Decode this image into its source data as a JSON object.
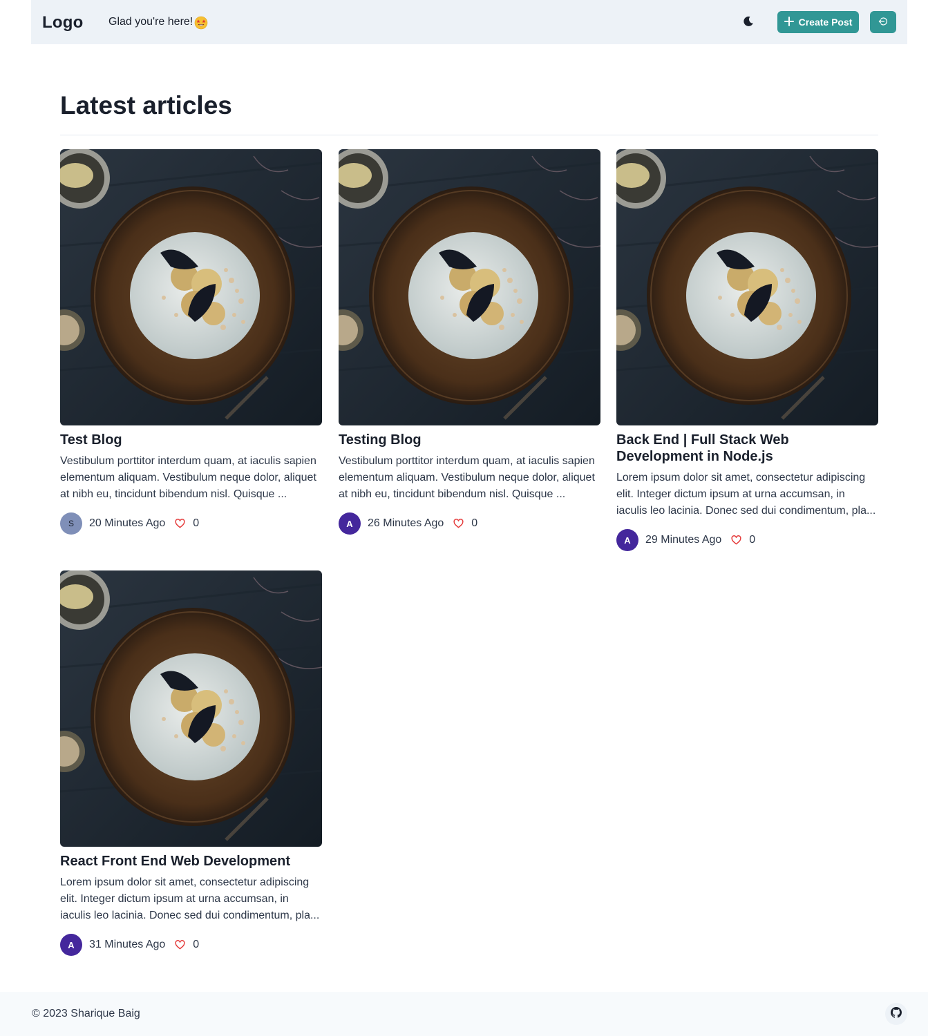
{
  "header": {
    "logo": "Logo",
    "greeting": "Glad you're here!",
    "create_label": "Create Post",
    "accent": "#319795"
  },
  "main": {
    "title": "Latest articles",
    "articles": [
      {
        "title": "Test Blog",
        "description": "Vestibulum porttitor interdum quam, at iaculis sapien elementum aliquam. Vestibulum neque dolor, aliquet at nibh eu, tincidunt bibendum nisl. Quisque ...",
        "avatar_initial": "S",
        "avatar_color": "#7f8fb8",
        "time": "20 Minutes Ago",
        "likes": "0"
      },
      {
        "title": "Testing Blog",
        "description": "Vestibulum porttitor interdum quam, at iaculis sapien elementum aliquam. Vestibulum neque dolor, aliquet at nibh eu, tincidunt bibendum nisl. Quisque ...",
        "avatar_initial": "A",
        "avatar_color": "#44279c",
        "time": "26 Minutes Ago",
        "likes": "0"
      },
      {
        "title": "Back End | Full Stack Web Development in Node.js",
        "description": "Lorem ipsum dolor sit amet, consectetur adipiscing elit. Integer dictum ipsum at urna accumsan, in iaculis leo lacinia. Donec sed dui condimentum, pla...",
        "avatar_initial": "A",
        "avatar_color": "#44279c",
        "time": "29 Minutes Ago",
        "likes": "0"
      },
      {
        "title": "React Front End Web Development",
        "description": "Lorem ipsum dolor sit amet, consectetur adipiscing elit. Integer dictum ipsum at urna accumsan, in iaculis leo lacinia. Donec sed dui condimentum, pla...",
        "avatar_initial": "A",
        "avatar_color": "#44279c",
        "time": "31 Minutes Ago",
        "likes": "0"
      }
    ]
  },
  "footer": {
    "copyright": "© 2023 Sharique Baig"
  },
  "icons": {
    "theme": "moon-icon",
    "create": "plus-icon",
    "logout": "logout-icon",
    "like": "heart-icon",
    "footer": "github-icon"
  }
}
